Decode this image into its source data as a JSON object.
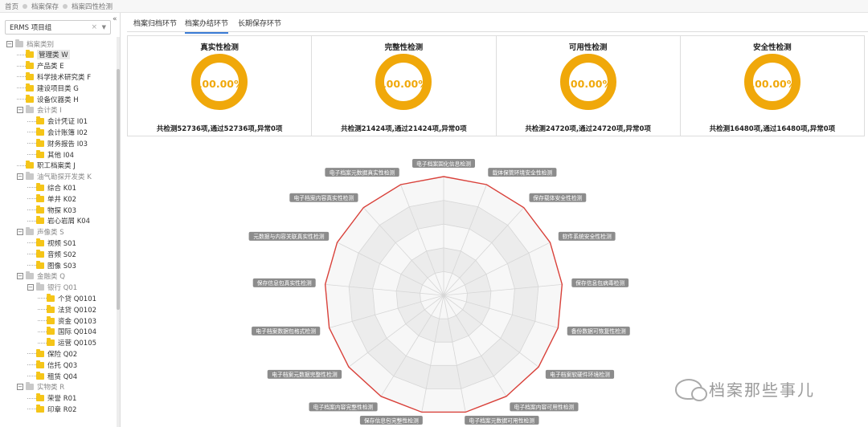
{
  "breadcrumb": [
    "首页",
    "档案保存",
    "档案四性检测"
  ],
  "sidebar": {
    "collapse_icon": "«",
    "project_select": {
      "value": "ERMS 项目组",
      "clear": "×",
      "arrow": "▼"
    },
    "tree": [
      {
        "label": "档案类别",
        "level": 0,
        "toggle": "−",
        "folder": "grey",
        "muted": true
      },
      {
        "label": "管理类 W",
        "level": 1,
        "folder": "yellow",
        "selected": true
      },
      {
        "label": "产品类 E",
        "level": 1,
        "folder": "yellow"
      },
      {
        "label": "科学技术研究类 F",
        "level": 1,
        "folder": "yellow"
      },
      {
        "label": "建设项目类 G",
        "level": 1,
        "folder": "yellow"
      },
      {
        "label": "设备仪器类 H",
        "level": 1,
        "folder": "yellow"
      },
      {
        "label": "会计类 I",
        "level": 1,
        "toggle": "−",
        "folder": "grey",
        "muted": true
      },
      {
        "label": "会计凭证 I01",
        "level": 2,
        "folder": "yellow"
      },
      {
        "label": "会计账簿 I02",
        "level": 2,
        "folder": "yellow"
      },
      {
        "label": "财务报告 I03",
        "level": 2,
        "folder": "yellow"
      },
      {
        "label": "其他 I04",
        "level": 2,
        "folder": "yellow"
      },
      {
        "label": "职工档案类 J",
        "level": 1,
        "folder": "yellow"
      },
      {
        "label": "油气勘探开发类 K",
        "level": 1,
        "toggle": "−",
        "folder": "grey",
        "muted": true
      },
      {
        "label": "综合 K01",
        "level": 2,
        "folder": "yellow"
      },
      {
        "label": "单井 K02",
        "level": 2,
        "folder": "yellow"
      },
      {
        "label": "物探 K03",
        "level": 2,
        "folder": "yellow"
      },
      {
        "label": "岩心岩屑 K04",
        "level": 2,
        "folder": "yellow"
      },
      {
        "label": "声像类 S",
        "level": 1,
        "toggle": "−",
        "folder": "grey",
        "muted": true
      },
      {
        "label": "视频 S01",
        "level": 2,
        "folder": "yellow"
      },
      {
        "label": "音频 S02",
        "level": 2,
        "folder": "yellow"
      },
      {
        "label": "图像 S03",
        "level": 2,
        "folder": "yellow"
      },
      {
        "label": "金融类 Q",
        "level": 1,
        "toggle": "−",
        "folder": "grey",
        "muted": true
      },
      {
        "label": "银行 Q01",
        "level": 2,
        "toggle": "−",
        "folder": "grey",
        "muted": true
      },
      {
        "label": "个贷 Q0101",
        "level": 3,
        "folder": "yellow"
      },
      {
        "label": "法贷 Q0102",
        "level": 3,
        "folder": "yellow"
      },
      {
        "label": "资金 Q0103",
        "level": 3,
        "folder": "yellow"
      },
      {
        "label": "国际 Q0104",
        "level": 3,
        "folder": "yellow"
      },
      {
        "label": "运营 Q0105",
        "level": 3,
        "folder": "yellow"
      },
      {
        "label": "保险 Q02",
        "level": 2,
        "folder": "yellow"
      },
      {
        "label": "信托 Q03",
        "level": 2,
        "folder": "yellow"
      },
      {
        "label": "租赁 Q04",
        "level": 2,
        "folder": "yellow"
      },
      {
        "label": "实物类 R",
        "level": 1,
        "toggle": "−",
        "folder": "grey",
        "muted": true
      },
      {
        "label": "荣誉 R01",
        "level": 2,
        "folder": "yellow"
      },
      {
        "label": "印章 R02",
        "level": 2,
        "folder": "yellow"
      }
    ]
  },
  "tabs": [
    {
      "label": "档案归档环节",
      "active": false
    },
    {
      "label": "档案办结环节",
      "active": true
    },
    {
      "label": "长期保存环节",
      "active": false
    }
  ],
  "cards": [
    {
      "title": "真实性检测",
      "percent": "100.00%",
      "summary": "共检测52736项,通过52736项,异常0项"
    },
    {
      "title": "完整性检测",
      "percent": "100.00%",
      "summary": "共检测21424项,通过21424项,异常0项"
    },
    {
      "title": "可用性检测",
      "percent": "100.00%",
      "summary": "共检测24720项,通过24720项,异常0项"
    },
    {
      "title": "安全性检测",
      "percent": "100.00%",
      "summary": "共检测16480项,通过16480项,异常0项"
    }
  ],
  "chart_data": {
    "type": "radar",
    "indicators": [
      "电子档案固化信息检测",
      "载体保管环境安全性检测",
      "保存载体安全性检测",
      "软件系统安全性检测",
      "保存信息包病毒检测",
      "备份数据可恢复性检测",
      "电子档案软硬件环境检测",
      "电子档案内容可用性检测",
      "电子档案元数据可用性检测",
      "保存信息包完整性检测",
      "电子档案内容完整性检测",
      "电子档案元数据完整性检测",
      "电子档案数据包格式检测",
      "保存信息包真实性检测",
      "元数据与内容关联真实性检测",
      "电子档案内容真实性检测",
      "电子档案元数据真实性检测"
    ],
    "values": [
      100,
      100,
      100,
      100,
      100,
      100,
      100,
      100,
      100,
      100,
      100,
      100,
      100,
      100,
      100,
      100,
      100
    ],
    "max": 100,
    "rings": 5,
    "line_color": "#d9413a"
  },
  "colors": {
    "accent": "#f0a80a",
    "tab_active": "#3a7bd5"
  },
  "watermark": "档案那些事儿"
}
